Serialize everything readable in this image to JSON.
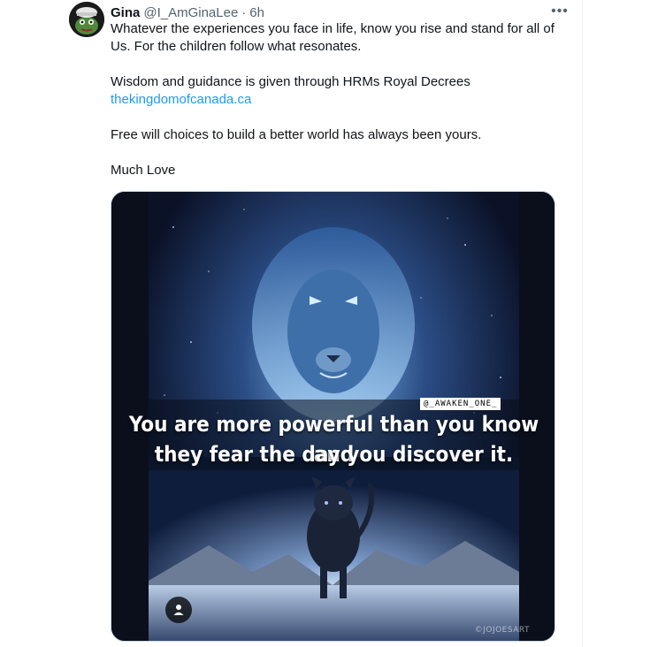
{
  "tweet": {
    "author_name": "Gina",
    "author_handle": "@I_AmGinaLee",
    "separator": "·",
    "time": "6h",
    "more_icon": "more-horizontal-icon",
    "paragraphs": [
      "Whatever the experiences you face in life, know you rise and stand for all of Us. For the children follow what resonates.",
      "Wisdom and guidance is given through HRMs Royal Decrees",
      "Free will choices to build a better world has always been yours.",
      "Much Love"
    ],
    "link_text": "thekingdomofcanada.ca",
    "colors": {
      "link": "#1d9bf0",
      "secondary": "#536471",
      "text": "#0f1419"
    }
  },
  "media": {
    "caption_line1": "You are more powerful than you know and",
    "caption_line2": "they fear the day you discover it.",
    "watermark_top": "@_AWAKEN_ONE_",
    "watermark_bottom": "©JOJOESART",
    "alt_icon": "person-icon"
  }
}
